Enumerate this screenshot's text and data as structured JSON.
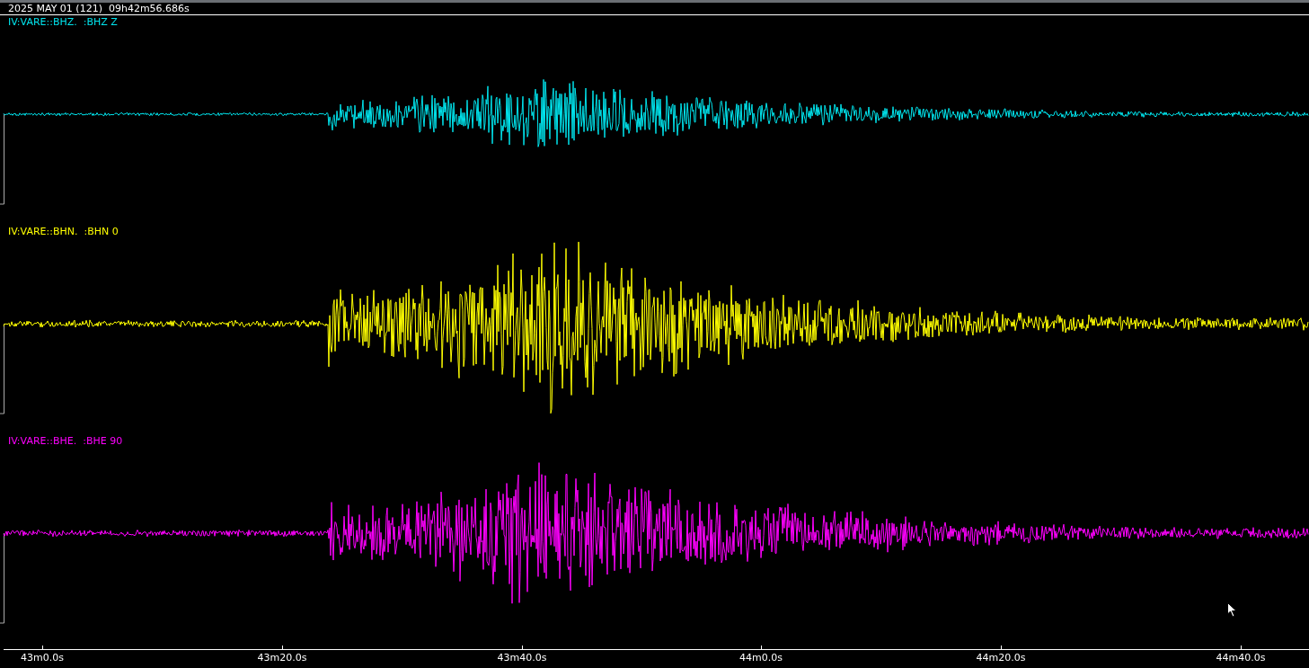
{
  "header": {
    "date": "2025 MAY 01 (121)  09h42m56.686s"
  },
  "traces": [
    {
      "label": "IV:VARE::BHZ.  :BHZ Z",
      "color": "#00e5ee"
    },
    {
      "label": "IV:VARE::BHN.  :BHN 0",
      "color": "#ffff00"
    },
    {
      "label": "IV:VARE::BHE.  :BHE 90",
      "color": "#ff00ff"
    }
  ],
  "time_axis": {
    "ticks": [
      "43m0.0s",
      "43m20.0s",
      "43m40.0s",
      "44m0.0s",
      "44m20.0s",
      "44m40.0s"
    ]
  }
}
